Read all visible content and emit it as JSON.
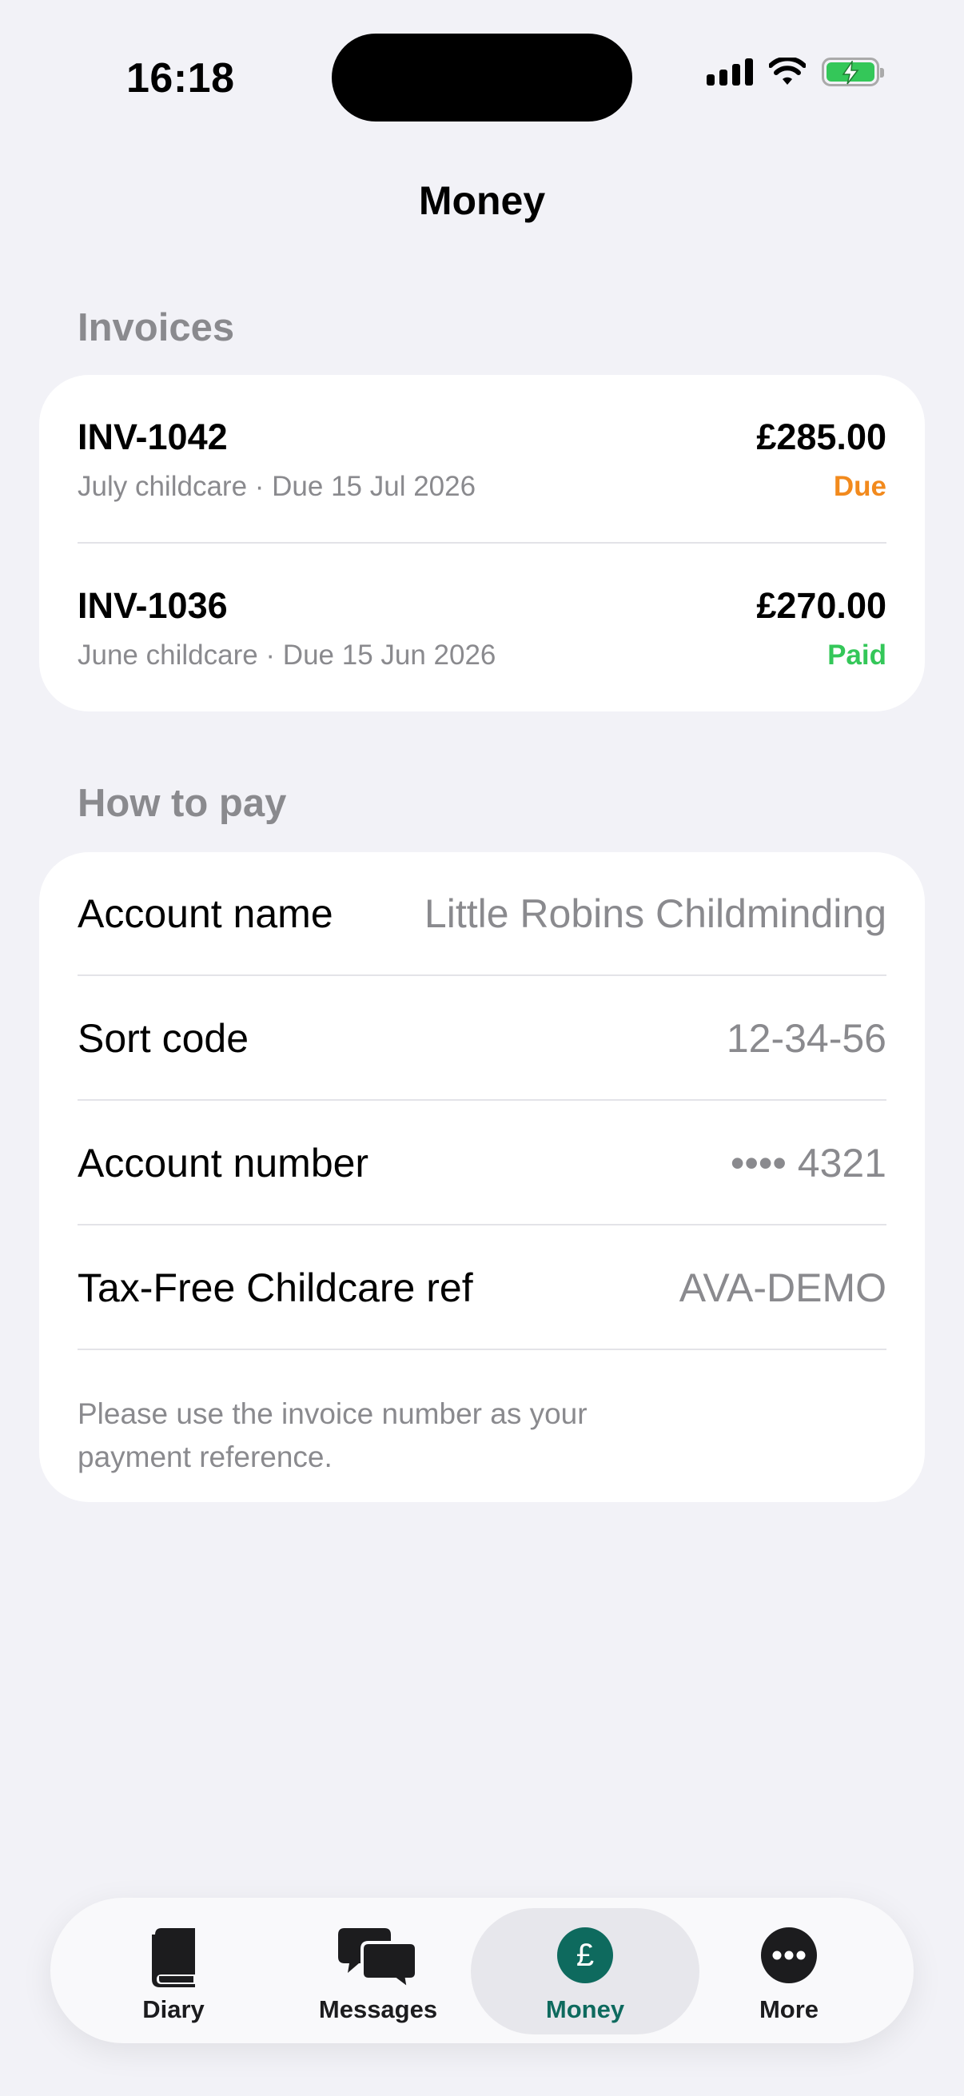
{
  "status_bar": {
    "time": "16:18"
  },
  "nav": {
    "title": "Money"
  },
  "invoices": {
    "header": "Invoices",
    "items": [
      {
        "id": "INV-1042",
        "description": "July childcare · Due 15 Jul 2026",
        "amount": "£285.00",
        "status": "Due",
        "status_color": "#f28a1d"
      },
      {
        "id": "INV-1036",
        "description": "June childcare · Due 15 Jun 2026",
        "amount": "£270.00",
        "status": "Paid",
        "status_color": "#34c759"
      }
    ]
  },
  "how_to_pay": {
    "header": "How to pay",
    "rows": [
      {
        "label": "Account name",
        "value": "Little Robins Childminding"
      },
      {
        "label": "Sort code",
        "value": "12-34-56"
      },
      {
        "label": "Account number",
        "value": "•••• 4321"
      },
      {
        "label": "Tax-Free Childcare ref",
        "value": "AVA-DEMO"
      }
    ],
    "note": "Please use the invoice number as your payment reference."
  },
  "tab_bar": {
    "tabs": [
      {
        "label": "Diary",
        "icon": "book-icon"
      },
      {
        "label": "Messages",
        "icon": "chat-bubbles-icon"
      },
      {
        "label": "Money",
        "icon": "pound-icon",
        "active": true
      },
      {
        "label": "More",
        "icon": "ellipsis-icon"
      }
    ],
    "active_color": "#0e6a5e"
  }
}
